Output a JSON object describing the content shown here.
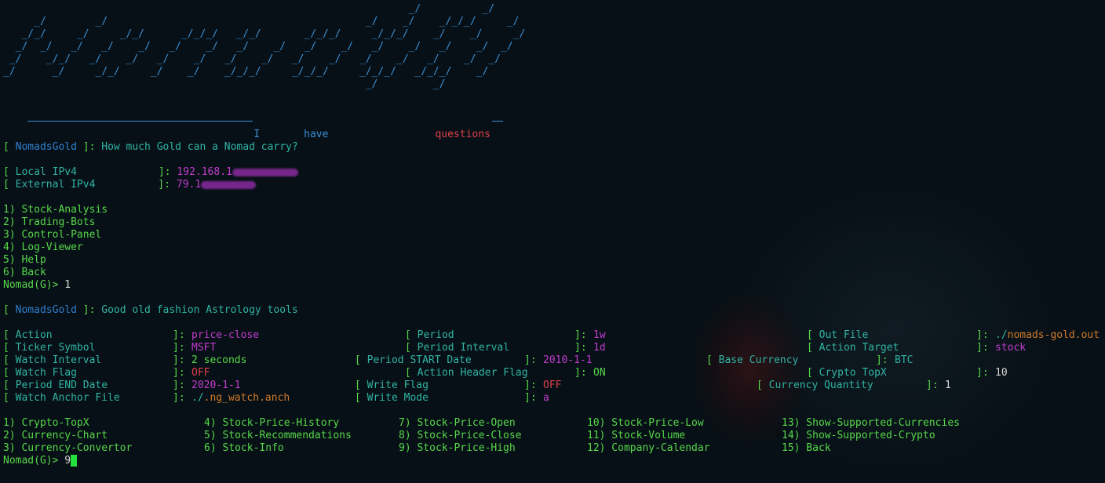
{
  "banner": {
    "lines": [
      "                                                                  _/          _/",
      "     _/        _/                                          _/    _/    _/_/_/     _/",
      "   _/_/     _/     _/_/      _/_/_/   _/_/       _/_/_/     _/_/_/    _/    _/     _/",
      "  _/  _/   _/   _/    _/   _/    _/   _/    _/   _/    _/   _/    _/   _/    _/  _/",
      " _/    _/_/   _/    _/   _/    _/   _/    _/   _/    _/   _/    _/   _/    _/  _/",
      "_/      _/     _/_/     _/    _/    _/_/_/     _/_/_/     _/_/_/   _/_/_/    _/",
      "                                                           _/         _/"
    ],
    "tagline_i": "I",
    "tagline_have": "have",
    "tagline_questions": "questions"
  },
  "intro": {
    "tag": "NomadsGold",
    "text": "How much Gold can a Nomad carry?"
  },
  "network": {
    "local_label": "Local IPv4",
    "local_value": "192.168.1",
    "external_label": "External IPv4",
    "external_value": "79.1"
  },
  "main_menu": [
    "1) Stock-Analysis",
    "2) Trading-Bots",
    "3) Control-Panel",
    "4) Log-Viewer",
    "5) Help",
    "6) Back"
  ],
  "prompt1": {
    "prompt": "Nomad(G)>",
    "input": "1"
  },
  "section": {
    "tag": "NomadsGold",
    "text": "Good old fashion Astrology tools"
  },
  "settings": {
    "action": {
      "label": "Action",
      "value": "price-close"
    },
    "period": {
      "label": "Period",
      "value": "1w"
    },
    "out_file": {
      "label": "Out File",
      "value_prefix": "./",
      "value": "nomads-gold.out"
    },
    "ticker_symbol": {
      "label": "Ticker Symbol",
      "value": "MSFT"
    },
    "period_interval": {
      "label": "Period Interval",
      "value": "1d"
    },
    "action_target": {
      "label": "Action Target",
      "value": "stock"
    },
    "watch_interval": {
      "label": "Watch Interval",
      "value": "2 seconds"
    },
    "period_start": {
      "label": "Period START Date",
      "value": "2010-1-1"
    },
    "base_currency": {
      "label": "Base Currency",
      "value": "BTC"
    },
    "watch_flag": {
      "label": "Watch Flag",
      "value": "OFF"
    },
    "action_header_flag": {
      "label": "Action Header Flag",
      "value": "ON"
    },
    "crypto_topx": {
      "label": "Crypto TopX",
      "value": "10"
    },
    "period_end": {
      "label": "Period END Date",
      "value": "2020-1-1"
    },
    "write_flag": {
      "label": "Write Flag",
      "value": "OFF"
    },
    "currency_quantity": {
      "label": "Currency Quantity",
      "value": "1"
    },
    "watch_anchor": {
      "label": "Watch Anchor File",
      "value_prefix": "./",
      "value": ".ng_watch.anch"
    },
    "write_mode": {
      "label": "Write Mode",
      "value": "a"
    }
  },
  "sub_menu": [
    [
      "1) Crypto-TopX",
      "4) Stock-Price-History",
      "7) Stock-Price-Open",
      "10) Stock-Price-Low",
      "13) Show-Supported-Currencies"
    ],
    [
      "2) Currency-Chart",
      "5) Stock-Recommendations",
      "8) Stock-Price-Close",
      "11) Stock-Volume",
      "14) Show-Supported-Crypto"
    ],
    [
      "3) Currency-Convertor",
      "6) Stock-Info",
      "9) Stock-Price-High",
      "12) Company-Calendar",
      "15) Back"
    ]
  ],
  "prompt2": {
    "prompt": "Nomad(G)>",
    "input": "9"
  },
  "colors": {
    "background": "#071016",
    "bracket_blue": "#3a8fd6",
    "menu_green": "#57d84a",
    "info_teal": "#30b4a4",
    "value_magenta": "#c23ccf",
    "alert_red": "#e0404c",
    "cursor_green": "#23e03a"
  }
}
